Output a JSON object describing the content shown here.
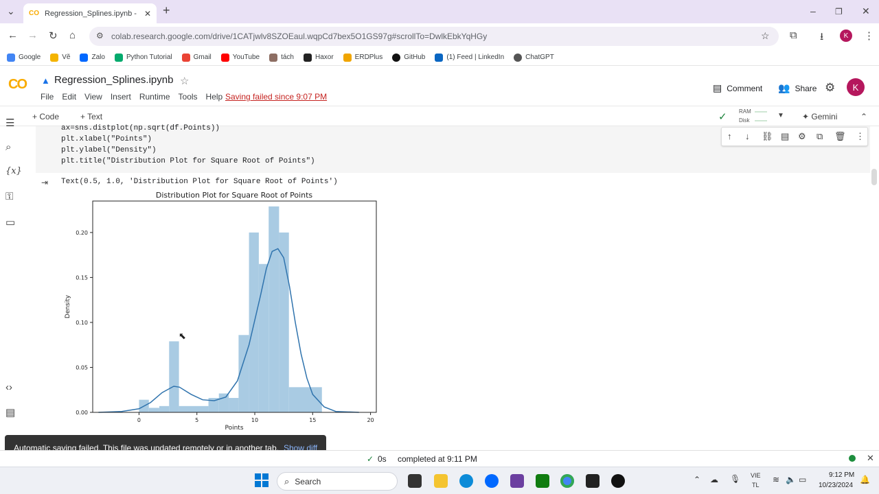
{
  "browser": {
    "tab_title": "Regression_Splines.ipynb - Cola",
    "url": "colab.research.google.com/drive/1CATjwlv8SZOEaul.wqpCd7bex5O1GS97g#scrollTo=DwlkEbkYqHGy",
    "profile_initial": "K",
    "bookmarks": [
      "Google",
      "Vẽ",
      "Zalo",
      "Python Tutorial",
      "Gmail",
      "YouTube",
      "tách",
      "Haxor",
      "ERDPlus",
      "GitHub",
      "(1) Feed | LinkedIn",
      "ChatGPT"
    ]
  },
  "colab": {
    "logo": "CO",
    "notebook_title": "Regression_Splines.ipynb",
    "menu": [
      "File",
      "Edit",
      "View",
      "Insert",
      "Runtime",
      "Tools",
      "Help"
    ],
    "save_status": "Saving failed since 9:07 PM",
    "comment_label": "Comment",
    "share_label": "Share",
    "user_initial": "K",
    "add_code": "+ Code",
    "add_text": "+ Text",
    "ram_label": "RAM",
    "disk_label": "Disk",
    "gemini_label": "Gemini"
  },
  "cell": {
    "lines": [
      "ax=sns.distplot(np.sqrt(df.Points))",
      "plt.xlabel(\"Points\")",
      "plt.ylabel(\"Density\")",
      "plt.title(\"Distribution Plot for Square Root of Points\")"
    ],
    "output_text": "Text(0.5, 1.0, 'Distribution Plot for Square Root of Points')"
  },
  "chart_data": {
    "type": "bar",
    "title": "Distribution Plot for Square Root of Points",
    "xlabel": "Points",
    "ylabel": "Density",
    "xlim": [
      -4,
      20.5
    ],
    "ylim": [
      0,
      0.235
    ],
    "xticks": [
      0,
      5,
      10,
      15,
      20
    ],
    "yticks": [
      "0.00",
      "0.05",
      "0.10",
      "0.15",
      "0.20"
    ],
    "bins": [
      {
        "x0": 0,
        "x1": 0.85,
        "density": 0.014
      },
      {
        "x0": 0.85,
        "x1": 1.75,
        "density": 0.005
      },
      {
        "x0": 1.75,
        "x1": 2.6,
        "density": 0.007
      },
      {
        "x0": 2.6,
        "x1": 3.45,
        "density": 0.079
      },
      {
        "x0": 3.45,
        "x1": 6.0,
        "density": 0.007
      },
      {
        "x0": 6.0,
        "x1": 6.9,
        "density": 0.016
      },
      {
        "x0": 6.9,
        "x1": 7.75,
        "density": 0.021
      },
      {
        "x0": 7.75,
        "x1": 8.6,
        "density": 0.016
      },
      {
        "x0": 8.6,
        "x1": 9.5,
        "density": 0.086
      },
      {
        "x0": 9.5,
        "x1": 10.35,
        "density": 0.2
      },
      {
        "x0": 10.35,
        "x1": 11.2,
        "density": 0.165
      },
      {
        "x0": 11.2,
        "x1": 12.1,
        "density": 0.229
      },
      {
        "x0": 12.1,
        "x1": 12.95,
        "density": 0.2
      },
      {
        "x0": 12.95,
        "x1": 15.8,
        "density": 0.028
      }
    ],
    "kde": [
      [
        -3.5,
        0.0
      ],
      [
        -1.5,
        0.001
      ],
      [
        0,
        0.004
      ],
      [
        1,
        0.011
      ],
      [
        2,
        0.022
      ],
      [
        3,
        0.029
      ],
      [
        3.5,
        0.028
      ],
      [
        4.5,
        0.02
      ],
      [
        5.5,
        0.014
      ],
      [
        6.5,
        0.013
      ],
      [
        7.5,
        0.017
      ],
      [
        8.5,
        0.035
      ],
      [
        9.5,
        0.075
      ],
      [
        10.5,
        0.13
      ],
      [
        11,
        0.16
      ],
      [
        11.5,
        0.179
      ],
      [
        12,
        0.182
      ],
      [
        12.5,
        0.172
      ],
      [
        13,
        0.14
      ],
      [
        13.5,
        0.1
      ],
      [
        14,
        0.065
      ],
      [
        14.5,
        0.038
      ],
      [
        15,
        0.02
      ],
      [
        16,
        0.006
      ],
      [
        17,
        0.001
      ],
      [
        19,
        0.0
      ]
    ],
    "colors": {
      "bars": "#a9cbe3",
      "kde": "#2f73ad"
    }
  },
  "toast": {
    "message": "Automatic saving failed. This file was updated remotely or in another tab.",
    "action": "Show diff"
  },
  "status": {
    "exec_time": "0s",
    "completed": "completed at 9:11 PM"
  },
  "taskbar": {
    "search_placeholder": "Search",
    "lang_1": "VIE",
    "lang_2": "TL",
    "time": "9:12 PM",
    "date": "10/23/2024"
  }
}
